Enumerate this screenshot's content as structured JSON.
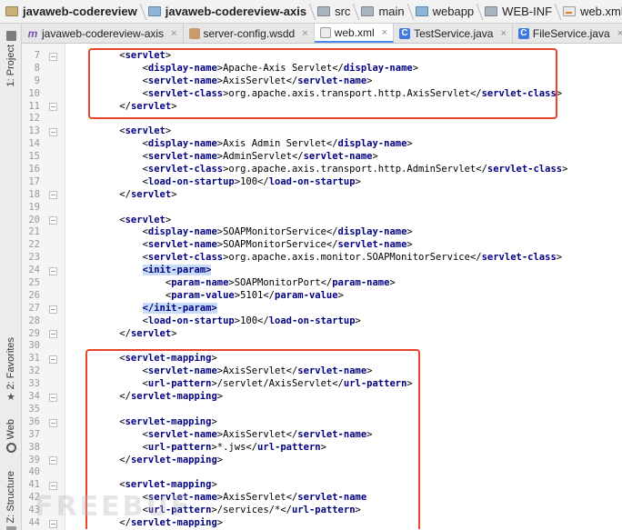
{
  "breadcrumb": [
    {
      "label": "javaweb-codereview",
      "icon": "project-folder-icon",
      "bold": true
    },
    {
      "label": "javaweb-codereview-axis",
      "icon": "module-folder-icon",
      "bold": true
    },
    {
      "label": "src",
      "icon": "folder-icon",
      "bold": false
    },
    {
      "label": "main",
      "icon": "folder-icon",
      "bold": false
    },
    {
      "label": "webapp",
      "icon": "web-folder-icon",
      "bold": false
    },
    {
      "label": "WEB-INF",
      "icon": "folder-icon",
      "bold": false
    },
    {
      "label": "web.xml",
      "icon": "xml-file-icon",
      "bold": false
    }
  ],
  "tabs": [
    {
      "label": "javaweb-codereview-axis",
      "icon": "maven-icon",
      "active": false
    },
    {
      "label": "server-config.wsdd",
      "icon": "config-file-icon",
      "active": false
    },
    {
      "label": "web.xml",
      "icon": "xml-file-icon",
      "active": true
    },
    {
      "label": "TestService.java",
      "icon": "java-class-icon",
      "active": false
    },
    {
      "label": "FileService.java",
      "icon": "java-class-icon",
      "active": false
    }
  ],
  "tab_close_glyph": "×",
  "tool_windows": {
    "project": "1: Project",
    "favorites": "2: Favorites",
    "web": "Web",
    "structure": "Z: Structure"
  },
  "watermark": "FREEBUF",
  "colors": {
    "annotation_red": "#e8452c",
    "tag_blue": "#000080",
    "selection": "#c8dcf8"
  },
  "code_lines": [
    {
      "n": "7",
      "segs": [
        [
          "p",
          "    <"
        ],
        [
          "t",
          "servlet"
        ],
        [
          "p",
          ">"
        ]
      ]
    },
    {
      "n": "8",
      "segs": [
        [
          "p",
          "        <"
        ],
        [
          "t",
          "display-name"
        ],
        [
          "p",
          ">"
        ],
        [
          "x",
          "Apache-Axis Servlet"
        ],
        [
          "p",
          "</"
        ],
        [
          "t",
          "display-name"
        ],
        [
          "p",
          ">"
        ]
      ]
    },
    {
      "n": "9",
      "segs": [
        [
          "p",
          "        <"
        ],
        [
          "t",
          "servlet-name"
        ],
        [
          "p",
          ">"
        ],
        [
          "x",
          "AxisServlet"
        ],
        [
          "p",
          "</"
        ],
        [
          "t",
          "servlet-name"
        ],
        [
          "p",
          ">"
        ]
      ]
    },
    {
      "n": "10",
      "segs": [
        [
          "p",
          "        <"
        ],
        [
          "t",
          "servlet-class"
        ],
        [
          "p",
          ">"
        ],
        [
          "x",
          "org.apache.axis.transport.http.AxisServlet"
        ],
        [
          "p",
          "</"
        ],
        [
          "t",
          "servlet-class"
        ],
        [
          "p",
          ">"
        ]
      ]
    },
    {
      "n": "11",
      "segs": [
        [
          "p",
          "    </"
        ],
        [
          "t",
          "servlet"
        ],
        [
          "p",
          ">"
        ]
      ]
    },
    {
      "n": "12",
      "segs": []
    },
    {
      "n": "13",
      "segs": [
        [
          "p",
          "    <"
        ],
        [
          "t",
          "servlet"
        ],
        [
          "p",
          ">"
        ]
      ]
    },
    {
      "n": "14",
      "segs": [
        [
          "p",
          "        <"
        ],
        [
          "t",
          "display-name"
        ],
        [
          "p",
          ">"
        ],
        [
          "x",
          "Axis Admin Servlet"
        ],
        [
          "p",
          "</"
        ],
        [
          "t",
          "display-name"
        ],
        [
          "p",
          ">"
        ]
      ]
    },
    {
      "n": "15",
      "segs": [
        [
          "p",
          "        <"
        ],
        [
          "t",
          "servlet-name"
        ],
        [
          "p",
          ">"
        ],
        [
          "x",
          "AdminServlet"
        ],
        [
          "p",
          "</"
        ],
        [
          "t",
          "servlet-name"
        ],
        [
          "p",
          ">"
        ]
      ]
    },
    {
      "n": "16",
      "segs": [
        [
          "p",
          "        <"
        ],
        [
          "t",
          "servlet-class"
        ],
        [
          "p",
          ">"
        ],
        [
          "x",
          "org.apache.axis.transport.http.AdminServlet"
        ],
        [
          "p",
          "</"
        ],
        [
          "t",
          "servlet-class"
        ],
        [
          "p",
          ">"
        ]
      ]
    },
    {
      "n": "17",
      "segs": [
        [
          "p",
          "        <"
        ],
        [
          "t",
          "load-on-startup"
        ],
        [
          "p",
          ">"
        ],
        [
          "x",
          "100"
        ],
        [
          "p",
          "</"
        ],
        [
          "t",
          "load-on-startup"
        ],
        [
          "p",
          ">"
        ]
      ]
    },
    {
      "n": "18",
      "segs": [
        [
          "p",
          "    </"
        ],
        [
          "t",
          "servlet"
        ],
        [
          "p",
          ">"
        ]
      ]
    },
    {
      "n": "19",
      "segs": []
    },
    {
      "n": "20",
      "segs": [
        [
          "p",
          "    <"
        ],
        [
          "t",
          "servlet"
        ],
        [
          "p",
          ">"
        ]
      ]
    },
    {
      "n": "21",
      "segs": [
        [
          "p",
          "        <"
        ],
        [
          "t",
          "display-name"
        ],
        [
          "p",
          ">"
        ],
        [
          "x",
          "SOAPMonitorService"
        ],
        [
          "p",
          "</"
        ],
        [
          "t",
          "display-name"
        ],
        [
          "p",
          ">"
        ]
      ]
    },
    {
      "n": "22",
      "segs": [
        [
          "p",
          "        <"
        ],
        [
          "t",
          "servlet-name"
        ],
        [
          "p",
          ">"
        ],
        [
          "x",
          "SOAPMonitorService"
        ],
        [
          "p",
          "</"
        ],
        [
          "t",
          "servlet-name"
        ],
        [
          "p",
          ">"
        ]
      ]
    },
    {
      "n": "23",
      "segs": [
        [
          "p",
          "        <"
        ],
        [
          "t",
          "servlet-class"
        ],
        [
          "p",
          ">"
        ],
        [
          "x",
          "org.apache.axis.monitor.SOAPMonitorService"
        ],
        [
          "p",
          "</"
        ],
        [
          "t",
          "servlet-class"
        ],
        [
          "p",
          ">"
        ]
      ]
    },
    {
      "n": "24",
      "segs": [
        [
          "p",
          "        "
        ],
        [
          "s",
          "<init-param>"
        ]
      ]
    },
    {
      "n": "25",
      "segs": [
        [
          "p",
          "            <"
        ],
        [
          "t",
          "param-name"
        ],
        [
          "p",
          ">"
        ],
        [
          "x",
          "SOAPMonitorPort"
        ],
        [
          "p",
          "</"
        ],
        [
          "t",
          "param-name"
        ],
        [
          "p",
          ">"
        ]
      ]
    },
    {
      "n": "26",
      "segs": [
        [
          "p",
          "            <"
        ],
        [
          "t",
          "param-value"
        ],
        [
          "p",
          ">"
        ],
        [
          "x",
          "5101"
        ],
        [
          "p",
          "</"
        ],
        [
          "t",
          "param-value"
        ],
        [
          "p",
          ">"
        ]
      ]
    },
    {
      "n": "27",
      "segs": [
        [
          "p",
          "        "
        ],
        [
          "s",
          "</init-param>"
        ]
      ]
    },
    {
      "n": "28",
      "segs": [
        [
          "p",
          "        <"
        ],
        [
          "t",
          "load-on-startup"
        ],
        [
          "p",
          ">"
        ],
        [
          "x",
          "100"
        ],
        [
          "p",
          "</"
        ],
        [
          "t",
          "load-on-startup"
        ],
        [
          "p",
          ">"
        ]
      ]
    },
    {
      "n": "29",
      "segs": [
        [
          "p",
          "    </"
        ],
        [
          "t",
          "servlet"
        ],
        [
          "p",
          ">"
        ]
      ]
    },
    {
      "n": "30",
      "segs": []
    },
    {
      "n": "31",
      "segs": [
        [
          "p",
          "    <"
        ],
        [
          "t",
          "servlet-mapping"
        ],
        [
          "p",
          ">"
        ]
      ]
    },
    {
      "n": "32",
      "segs": [
        [
          "p",
          "        <"
        ],
        [
          "t",
          "servlet-name"
        ],
        [
          "p",
          ">"
        ],
        [
          "x",
          "AxisServlet"
        ],
        [
          "p",
          "</"
        ],
        [
          "t",
          "servlet-name"
        ],
        [
          "p",
          ">"
        ]
      ]
    },
    {
      "n": "33",
      "segs": [
        [
          "p",
          "        <"
        ],
        [
          "t",
          "url-pattern"
        ],
        [
          "p",
          ">"
        ],
        [
          "x",
          "/servlet/AxisServlet"
        ],
        [
          "p",
          "</"
        ],
        [
          "t",
          "url-pattern"
        ],
        [
          "p",
          ">"
        ]
      ]
    },
    {
      "n": "34",
      "segs": [
        [
          "p",
          "    </"
        ],
        [
          "t",
          "servlet-mapping"
        ],
        [
          "p",
          ">"
        ]
      ]
    },
    {
      "n": "35",
      "segs": []
    },
    {
      "n": "36",
      "segs": [
        [
          "p",
          "    <"
        ],
        [
          "t",
          "servlet-mapping"
        ],
        [
          "p",
          ">"
        ]
      ]
    },
    {
      "n": "37",
      "segs": [
        [
          "p",
          "        <"
        ],
        [
          "t",
          "servlet-name"
        ],
        [
          "p",
          ">"
        ],
        [
          "x",
          "AxisServlet"
        ],
        [
          "p",
          "</"
        ],
        [
          "t",
          "servlet-name"
        ],
        [
          "p",
          ">"
        ]
      ]
    },
    {
      "n": "38",
      "segs": [
        [
          "p",
          "        <"
        ],
        [
          "t",
          "url-pattern"
        ],
        [
          "p",
          ">"
        ],
        [
          "x",
          "*.jws"
        ],
        [
          "p",
          "</"
        ],
        [
          "t",
          "url-pattern"
        ],
        [
          "p",
          ">"
        ]
      ]
    },
    {
      "n": "39",
      "segs": [
        [
          "p",
          "    </"
        ],
        [
          "t",
          "servlet-mapping"
        ],
        [
          "p",
          ">"
        ]
      ]
    },
    {
      "n": "40",
      "segs": []
    },
    {
      "n": "41",
      "segs": [
        [
          "p",
          "    <"
        ],
        [
          "t",
          "servlet-mapping"
        ],
        [
          "p",
          ">"
        ]
      ]
    },
    {
      "n": "42",
      "segs": [
        [
          "p",
          "        <"
        ],
        [
          "t",
          "servlet-name"
        ],
        [
          "p",
          ">"
        ],
        [
          "x",
          "AxisServlet"
        ],
        [
          "p",
          "</"
        ],
        [
          "t",
          "servlet-name"
        ]
      ]
    },
    {
      "n": "43",
      "segs": [
        [
          "p",
          "        <"
        ],
        [
          "t",
          "url-pattern"
        ],
        [
          "p",
          ">"
        ],
        [
          "x",
          "/services/*"
        ],
        [
          "p",
          "</"
        ],
        [
          "t",
          "url-pattern"
        ],
        [
          "p",
          ">"
        ]
      ]
    },
    {
      "n": "44",
      "segs": [
        [
          "p",
          "    </"
        ],
        [
          "t",
          "servlet-mapping"
        ],
        [
          "p",
          ">"
        ]
      ]
    }
  ]
}
